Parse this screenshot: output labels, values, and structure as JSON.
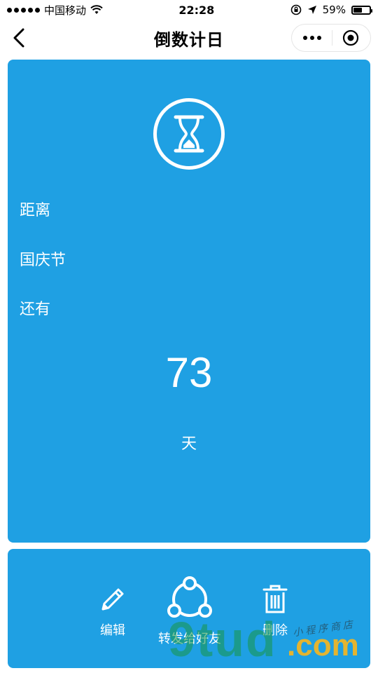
{
  "status_bar": {
    "carrier": "中国移动",
    "time": "22:28",
    "battery_percent": "59%",
    "battery_level": 0.59
  },
  "nav": {
    "title": "倒数计日"
  },
  "card": {
    "line1": "距离",
    "line2": "国庆节",
    "line3": "还有",
    "days_number": "73",
    "days_unit": "天"
  },
  "actions": {
    "edit_label": "编辑",
    "share_label": "转发给好友",
    "delete_label": "删除"
  },
  "watermark": {
    "main": "9tud",
    "dot": ".com",
    "sub": "小程序商店"
  },
  "colors": {
    "card_bg": "#1fa0e3",
    "text": "#ffffff"
  }
}
